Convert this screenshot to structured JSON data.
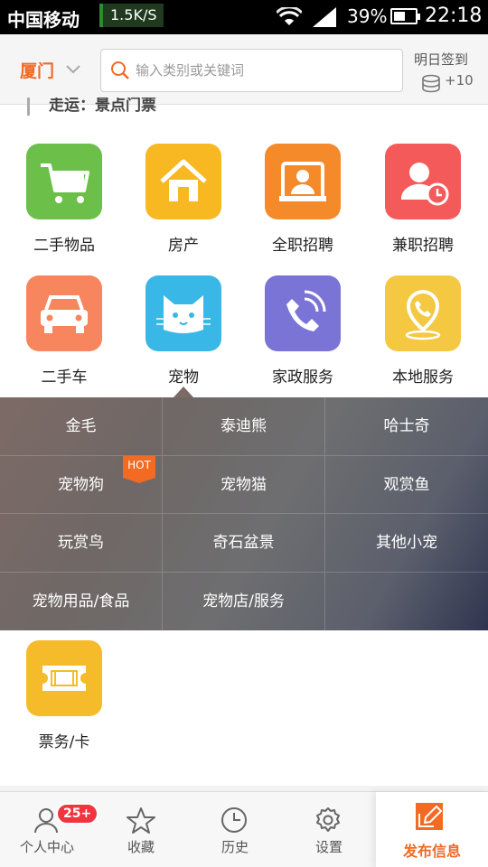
{
  "status_bar": {
    "carrier": "中国移动",
    "net_speed": "1.5K/S",
    "battery": "39%",
    "time": "22:18"
  },
  "header": {
    "city": "厦门",
    "search_placeholder": "输入类别或关键词",
    "signin_label": "明日签到",
    "signin_points": "+10"
  },
  "partial_text": "走运：景点门票",
  "categories": [
    {
      "label": "二手物品",
      "color": "#6cc04a",
      "icon": "shopping-cart-icon"
    },
    {
      "label": "房产",
      "color": "#f7b822",
      "icon": "house-icon"
    },
    {
      "label": "全职招聘",
      "color": "#f58a2a",
      "icon": "id-card-icon"
    },
    {
      "label": "兼职招聘",
      "color": "#f55a5a",
      "icon": "person-clock-icon"
    },
    {
      "label": "二手车",
      "color": "#f7855d",
      "icon": "car-icon"
    },
    {
      "label": "宠物",
      "color": "#39b7e6",
      "icon": "cat-icon"
    },
    {
      "label": "家政服务",
      "color": "#7a74d6",
      "icon": "phone-icon"
    },
    {
      "label": "本地服务",
      "color": "#f5c842",
      "icon": "location-phone-icon"
    },
    {
      "label": "票务/卡",
      "color": "#f5bb2a",
      "icon": "ticket-icon"
    }
  ],
  "pet_subcategories": {
    "rows": [
      [
        "金毛",
        "泰迪熊",
        "哈士奇"
      ],
      [
        "宠物狗",
        "宠物猫",
        "观赏鱼"
      ],
      [
        "玩赏鸟",
        "奇石盆景",
        "其他小宠"
      ],
      [
        "宠物用品/食品",
        "宠物店/服务",
        ""
      ]
    ],
    "hot_label": "HOT"
  },
  "tabbar": {
    "profile": "个人中心",
    "profile_badge": "25+",
    "favorites": "收藏",
    "history": "历史",
    "settings": "设置",
    "publish": "发布信息"
  }
}
